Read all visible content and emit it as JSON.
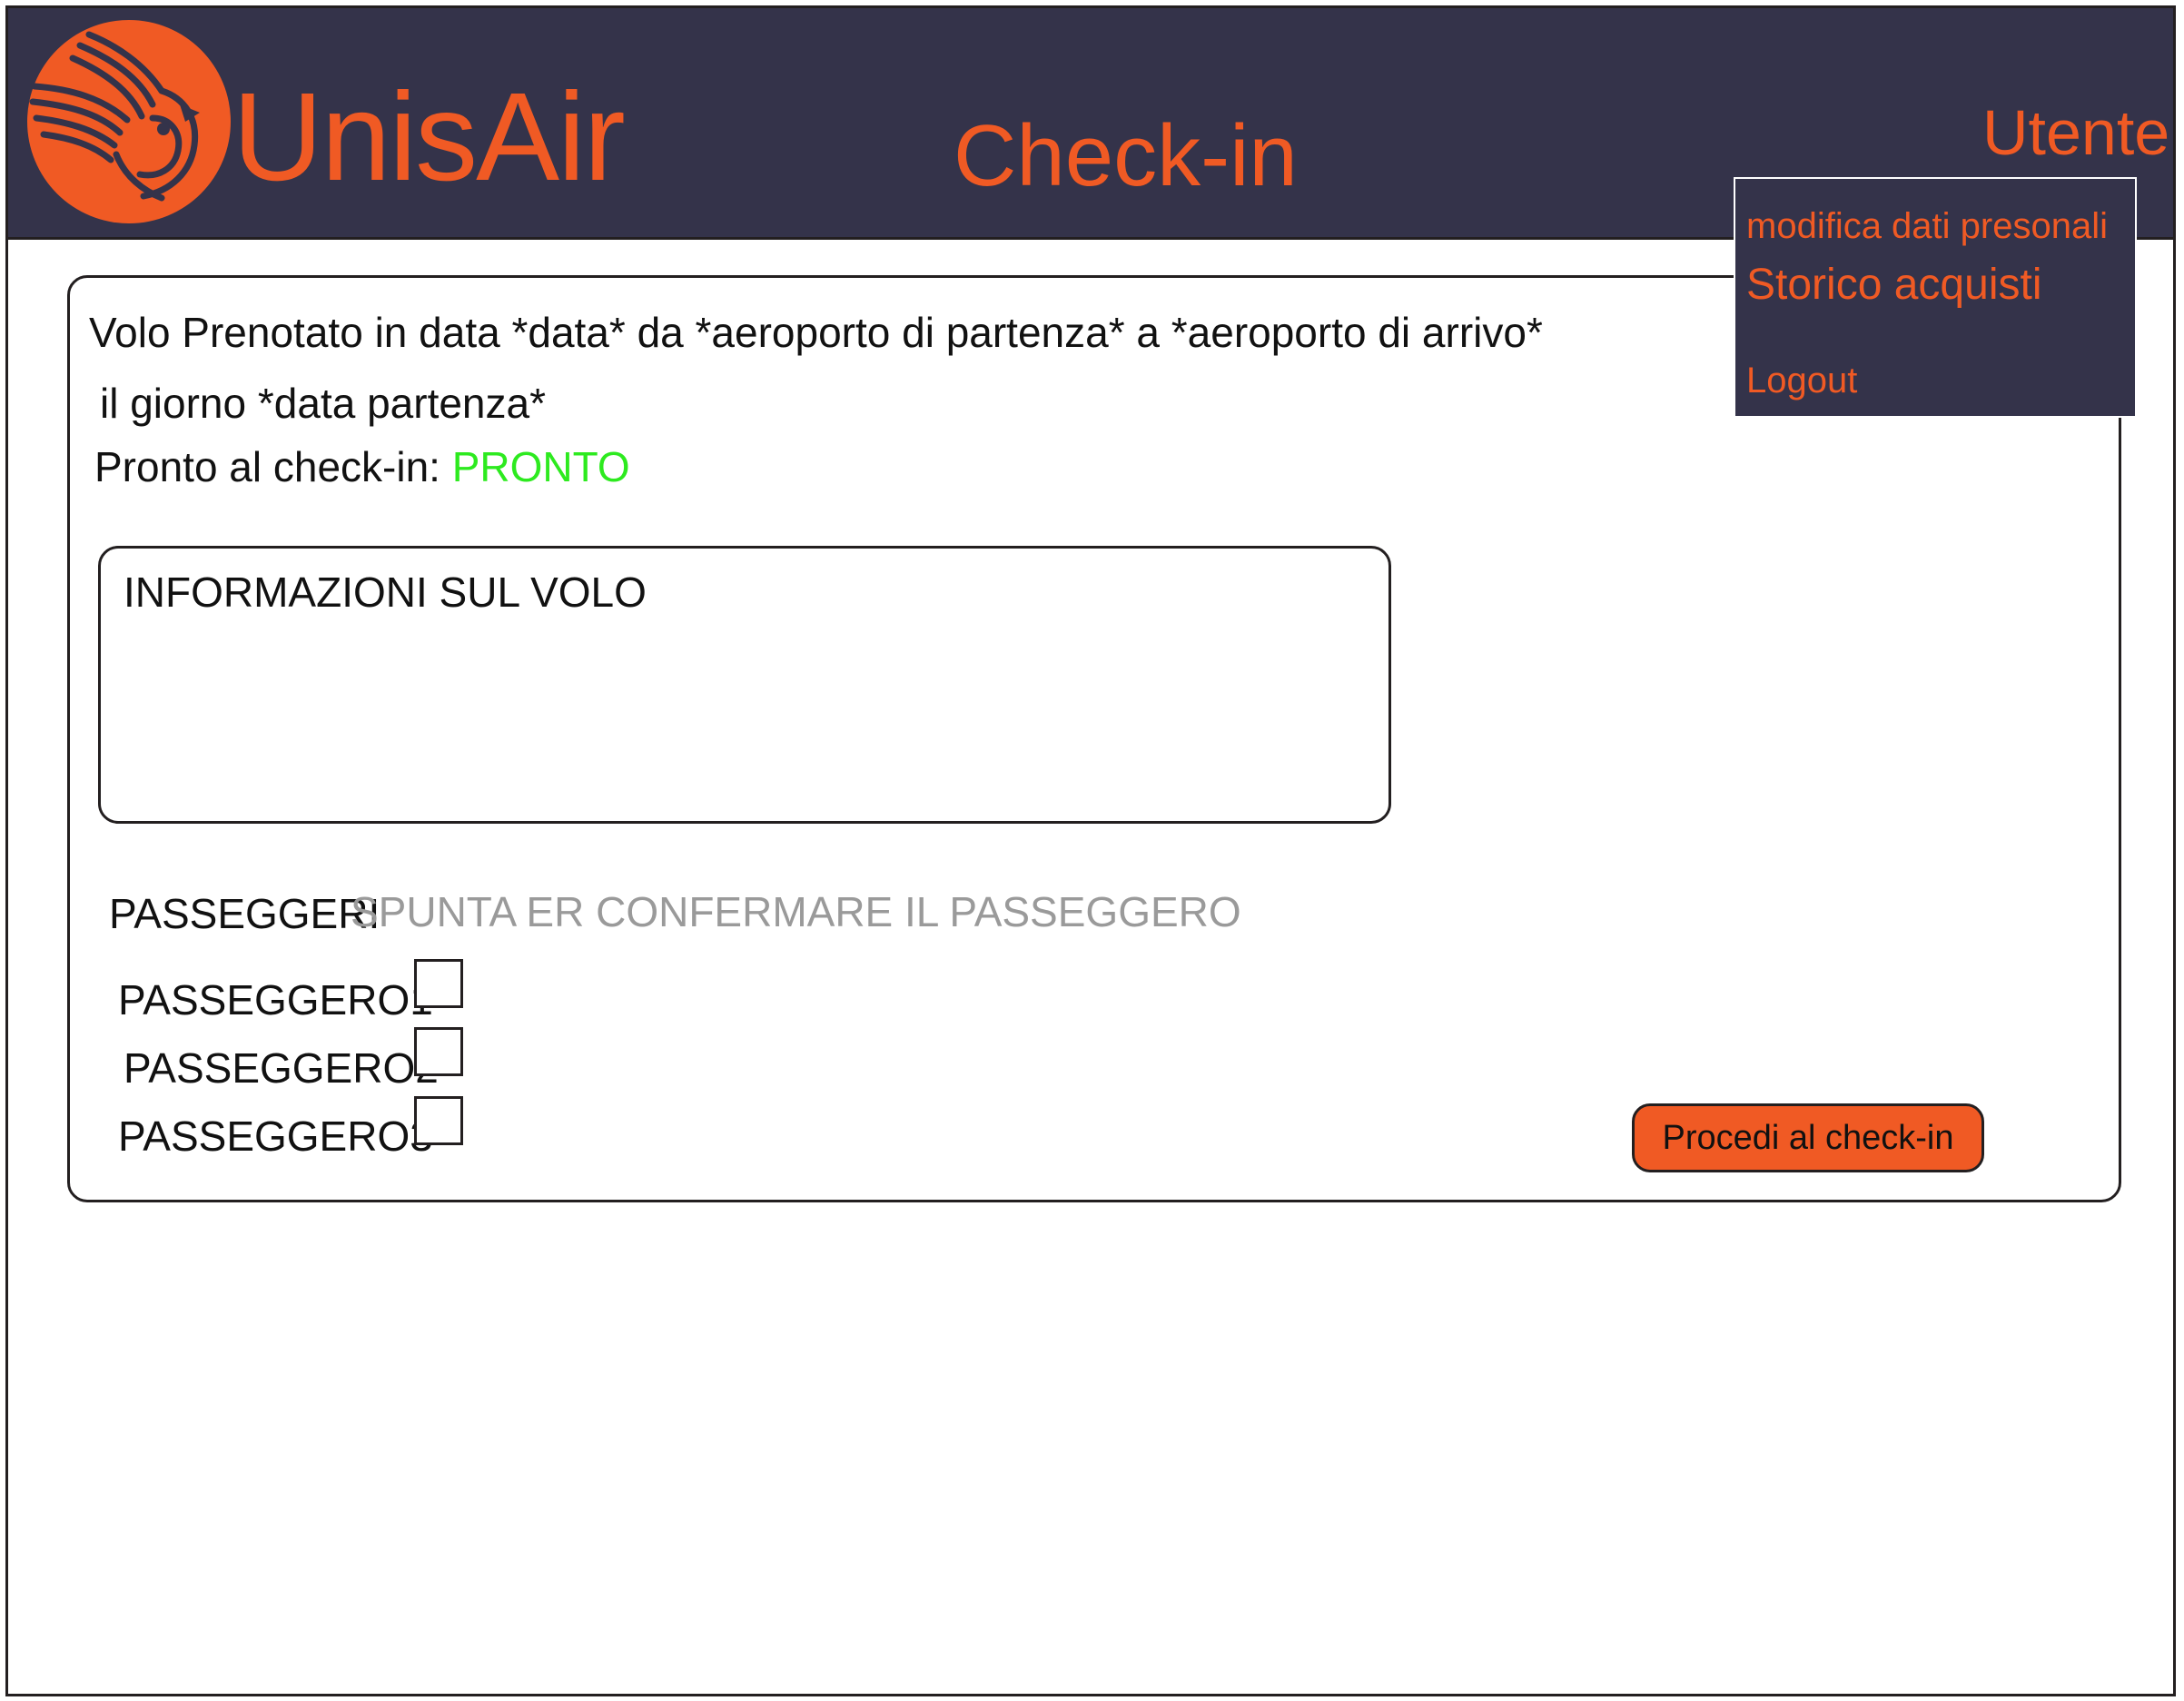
{
  "header": {
    "brand": "UnisAir",
    "page_title": "Check-in",
    "user_menu_label": "Utente"
  },
  "user_dropdown": {
    "items": [
      {
        "label": "modifica dati presonali"
      },
      {
        "label": "Storico acquisti"
      },
      {
        "label": "Logout"
      }
    ]
  },
  "booking": {
    "summary_line": "Volo Prenotato in data *data* da *aeroporto di partenza* a *aeroporto di arrivo*",
    "date_line": "il giorno *data partenza*",
    "ready_label": "Pronto al check-in: ",
    "ready_status": "PRONTO"
  },
  "flight_info": {
    "title": "INFORMAZIONI SUL VOLO"
  },
  "passengers": {
    "header": "PASSEGGERI",
    "hint": "SPUNTA ER CONFERMARE IL PASSEGGERO",
    "list": [
      {
        "name": "PASSEGGERO1",
        "checked": false
      },
      {
        "name": "PASSEGGERO2",
        "checked": false
      },
      {
        "name": "PASSEGGERO3",
        "checked": false
      }
    ]
  },
  "actions": {
    "proceed_label": "Procedi al check-in"
  },
  "colors": {
    "header_bg": "#34334a",
    "accent": "#f05a24",
    "status_ok": "#2dea1f",
    "hint": "#9a9a9a"
  },
  "icons": {
    "logo": "phoenix-logo-icon"
  }
}
